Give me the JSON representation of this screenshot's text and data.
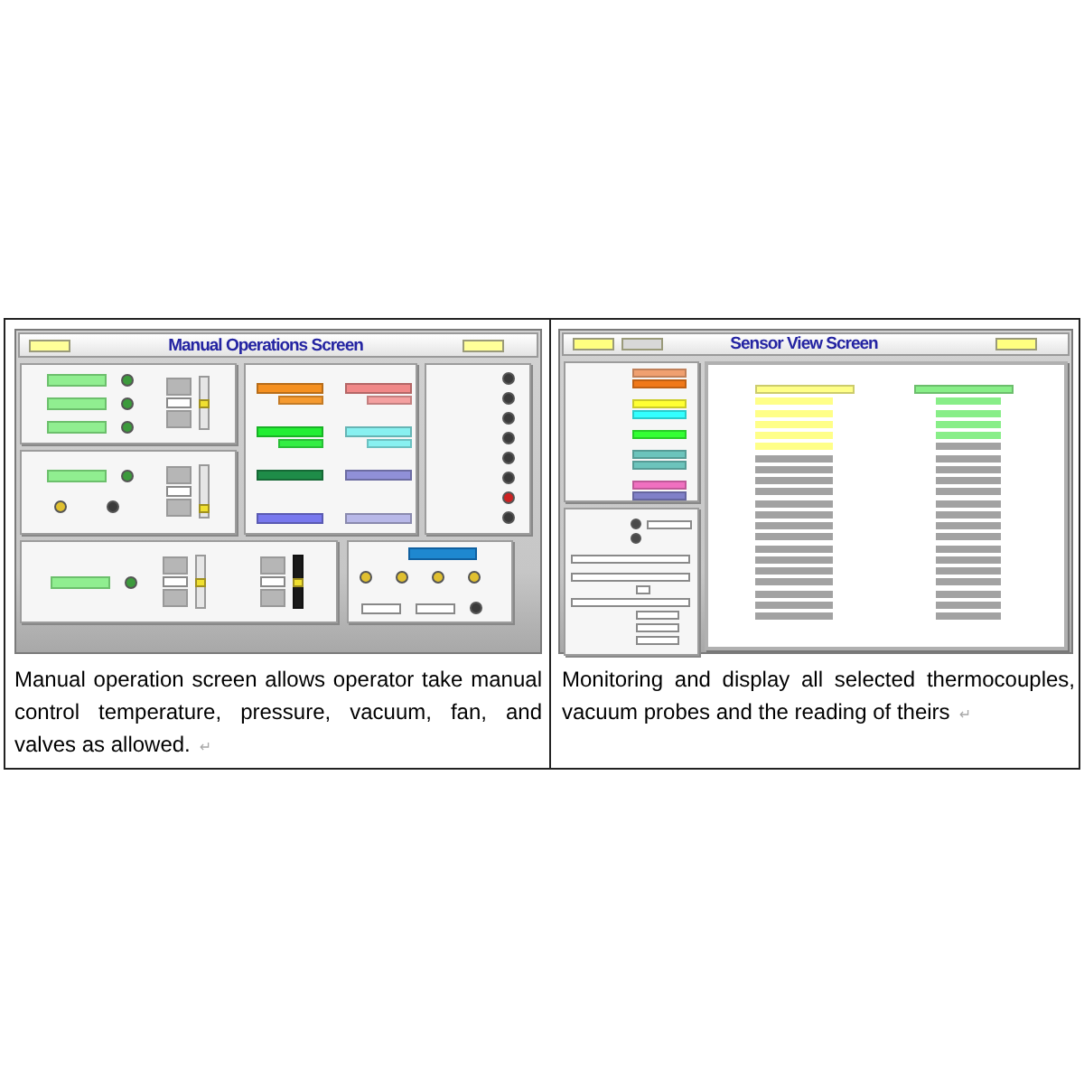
{
  "manual_screen": {
    "left_buttons": [
      {
        "color": "#ffff99"
      }
    ],
    "title": "Manual Operations Screen",
    "right_buttons": [
      {
        "color": "#ffff99"
      }
    ],
    "temperature_panel": {
      "rows": [
        {
          "color": "#3c9a3c"
        },
        {
          "color": "#3c9a3c"
        },
        {
          "color": "#3c9a3c"
        }
      ],
      "setpoint_slider": {
        "level": 0.5
      }
    },
    "pressure_panel": {
      "rows": [
        {
          "color": "#3c9a3c"
        }
      ],
      "indicators": [
        {
          "color": "#e0c030"
        },
        {
          "color": "#3a3a3a"
        }
      ],
      "setpoint_slider": {
        "level": 0.1
      }
    },
    "readings_panel": {
      "readings": [
        {
          "color": "#f59020",
          "setpoint": {
            "color": "#f59a30"
          }
        },
        {
          "color": "#f08888",
          "setpoint": {
            "color": "#f4a0a0"
          }
        },
        {
          "color": "#22ee33",
          "setpoint": {
            "color": "#33ee44"
          }
        },
        {
          "color": "#88f0f0",
          "setpoint": {
            "color": "#88f0f0"
          }
        },
        {
          "color": "#1e8c48"
        },
        {
          "color": "#9090d8"
        },
        {
          "color": "#7878ee"
        },
        {
          "color": "#b8b8e8"
        }
      ]
    },
    "alarm_panel": {
      "indicators": [
        {
          "color": "#3a3a3a"
        },
        {
          "color": "#3a3a3a"
        },
        {
          "color": "#3a3a3a"
        },
        {
          "color": "#3a3a3a"
        },
        {
          "color": "#3a3a3a"
        },
        {
          "color": "#3a3a3a"
        },
        {
          "color": "#cc2222"
        },
        {
          "color": "#3a3a3a"
        }
      ]
    },
    "vacuum_panel": {
      "rows": [
        {
          "color": "#3c9a3c"
        }
      ],
      "sliders": [
        {
          "kind": "light",
          "level": 0.5
        },
        {
          "kind": "dark",
          "level": 0.5
        }
      ]
    },
    "fan_panel": {
      "indicators": [
        {
          "color": "#e0c030"
        },
        {
          "color": "#e0c030"
        },
        {
          "color": "#e0c030"
        },
        {
          "color": "#e0c030"
        }
      ],
      "status_indicator": {
        "color": "#3a3a3a"
      }
    }
  },
  "sensor_screen": {
    "left_buttons": [
      {
        "color": "#ffff80"
      },
      {
        "color": "#d8d8d8"
      }
    ],
    "title": "Sensor View Screen",
    "right_buttons": [
      {
        "color": "#ffff80"
      }
    ],
    "readings_panel": {
      "groups": [
        {
          "readings": [
            {
              "color": "#f0a070"
            },
            {
              "color": "#f07818"
            }
          ]
        },
        {
          "readings": [
            {
              "color": "#ffff33"
            },
            {
              "color": "#33ffff"
            }
          ]
        },
        {
          "readings": [
            {
              "color": "#33ff33"
            }
          ]
        },
        {
          "readings": [
            {
              "color": "#6cc4bc"
            },
            {
              "color": "#6cc4bc"
            }
          ]
        },
        {
          "readings": [
            {
              "color": "#f070c0"
            },
            {
              "color": "#8080c8"
            }
          ]
        }
      ]
    },
    "status_panel": {
      "indicators": [
        {
          "color": "#4a4a4a"
        },
        {
          "color": "#4a4a4a"
        }
      ]
    },
    "sensor_lists": [
      {
        "color": "#ffff88",
        "rows": [
          {
            "selected": true
          },
          {
            "selected": true
          },
          {
            "selected": true
          },
          {
            "selected": true
          },
          {
            "selected": true
          },
          {
            "selected": false
          },
          {
            "selected": false
          },
          {
            "selected": false
          },
          {
            "selected": false
          },
          {
            "selected": false
          },
          {
            "selected": false
          },
          {
            "selected": false
          },
          {
            "selected": false
          },
          {
            "selected": false
          },
          {
            "selected": false
          },
          {
            "selected": false
          },
          {
            "selected": false
          },
          {
            "selected": false
          },
          {
            "selected": false
          },
          {
            "selected": false
          }
        ]
      },
      {
        "color": "#88ee88",
        "rows": [
          {
            "selected": true
          },
          {
            "selected": true
          },
          {
            "selected": true
          },
          {
            "selected": true
          },
          {
            "selected": false
          },
          {
            "selected": false
          },
          {
            "selected": false
          },
          {
            "selected": false
          },
          {
            "selected": false
          },
          {
            "selected": false
          },
          {
            "selected": false
          },
          {
            "selected": false
          },
          {
            "selected": false
          },
          {
            "selected": false
          },
          {
            "selected": false
          },
          {
            "selected": false
          },
          {
            "selected": false
          },
          {
            "selected": false
          },
          {
            "selected": false
          },
          {
            "selected": false
          }
        ]
      }
    ]
  },
  "captions": [
    {
      "text": "Manual operation screen allows operator take manual control temperature, pressure, vacuum, fan, and valves as allowed.",
      "mark": "↵"
    },
    {
      "text": "Monitoring and display all selected thermocouples, vacuum probes and the reading of theirs",
      "mark": "↵"
    }
  ]
}
